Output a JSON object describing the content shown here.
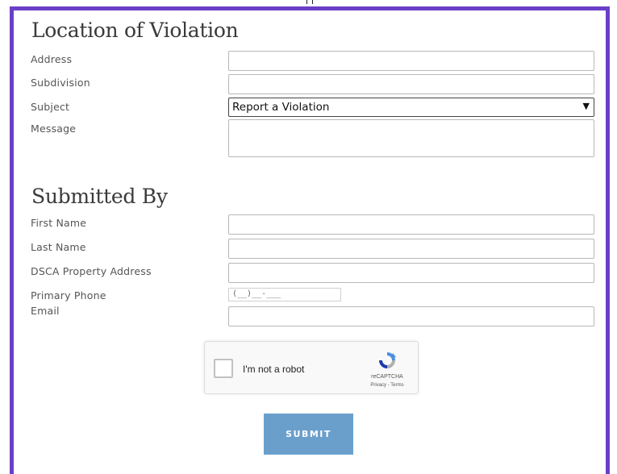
{
  "sections": {
    "location_title": "Location of Violation",
    "submitted_title": "Submitted By"
  },
  "location": {
    "address_label": "Address",
    "subdivision_label": "Subdivision",
    "subject_label": "Subject",
    "subject_value": "Report a Violation",
    "message_label": "Message"
  },
  "submitter": {
    "first_name_label": "First Name",
    "last_name_label": "Last Name",
    "property_label": "DSCA Property Address",
    "phone_label": "Primary Phone",
    "phone_mask": "(__)__-___",
    "email_label": "Email"
  },
  "captcha": {
    "checkbox_text": "I'm not a robot",
    "brand": "reCAPTCHA",
    "links": "Privacy - Terms"
  },
  "form": {
    "submit_label": "SUBMIT"
  },
  "colors": {
    "frame": "#6a3fc9",
    "submit": "#6a9fcb"
  }
}
